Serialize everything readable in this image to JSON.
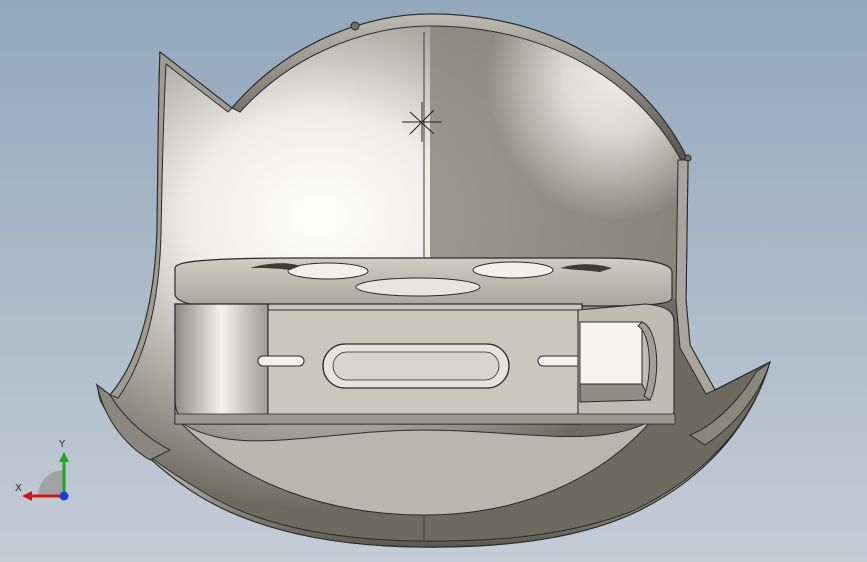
{
  "viewport": {
    "background_top": "#93a8bd",
    "background_bottom": "#c4ccd6"
  },
  "model": {
    "material_color": "#d7d5cc",
    "edge_color": "#2b2b2b",
    "description_icon": "sheet-metal-part"
  },
  "triad": {
    "x_label": "X",
    "y_label": "Y",
    "x_color": "#d01818",
    "y_color": "#19a819",
    "z_color": "#1a3fd6"
  }
}
